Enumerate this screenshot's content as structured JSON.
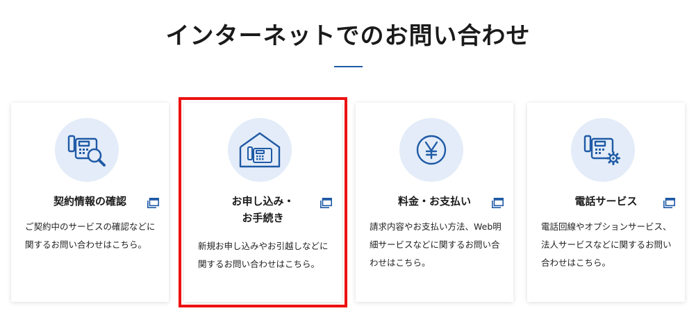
{
  "section": {
    "title": "インターネットでのお問い合わせ"
  },
  "cards": [
    {
      "icon": "phone-search-icon",
      "title_lines": [
        "契約情報の確認"
      ],
      "description": "ご契約中のサービスの確認などに関するお問い合わせはこちら。",
      "highlighted": false
    },
    {
      "icon": "home-phone-icon",
      "title_lines": [
        "お申し込み・",
        "お手続き"
      ],
      "description": "新規お申し込みやお引越しなどに関するお問い合わせはこちら。",
      "highlighted": true
    },
    {
      "icon": "yen-icon",
      "title_lines": [
        "料金・お支払い"
      ],
      "description": "請求内容やお支払い方法、Web明細サービスなどに関するお問い合わせはこちら。",
      "highlighted": false
    },
    {
      "icon": "phone-gear-icon",
      "title_lines": [
        "電話サービス"
      ],
      "description": "電話回線やオプションサービス、法人サービスなどに関するお問い合わせはこちら。",
      "highlighted": false
    }
  ],
  "colors": {
    "accent": "#1f5aa6",
    "icon_bg": "#e3ecf8",
    "highlight": "#ee1111"
  },
  "external_link_icon": "external-window-icon"
}
